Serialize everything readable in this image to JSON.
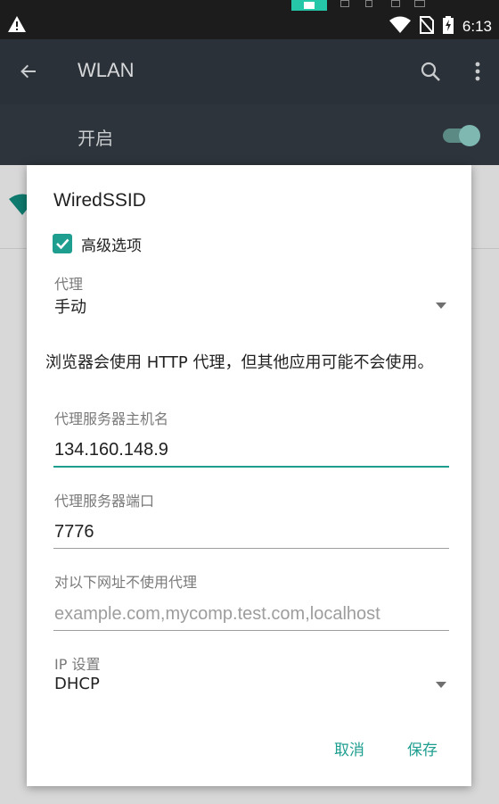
{
  "status_bar": {
    "time": "6:13"
  },
  "app_bar": {
    "title": "WLAN"
  },
  "switch_row": {
    "label": "开启",
    "enabled": true
  },
  "dialog": {
    "title": "WiredSSID",
    "advanced_options": {
      "label": "高级选项",
      "checked": true
    },
    "proxy": {
      "label": "代理",
      "value": "手动"
    },
    "note": "浏览器会使用 HTTP 代理，但其他应用可能不会使用。",
    "proxy_hostname": {
      "label": "代理服务器主机名",
      "value": "134.160.148.9"
    },
    "proxy_port": {
      "label": "代理服务器端口",
      "value": "7776"
    },
    "bypass": {
      "label": "对以下网址不使用代理",
      "placeholder": "example.com,mycomp.test.com,localhost"
    },
    "ip_settings": {
      "label": "IP 设置",
      "value": "DHCP"
    },
    "cancel_label": "取消",
    "save_label": "保存"
  },
  "colors": {
    "accent": "#1d9e8f",
    "appbar": "#2b3138",
    "statusbar": "#1c1c1c"
  },
  "icons": [
    "warning-icon",
    "wifi-status-icon",
    "no-sim-icon",
    "battery-charging-icon",
    "back-arrow-icon",
    "search-icon",
    "more-vert-icon",
    "wifi-icon",
    "checkbox-checked-icon",
    "dropdown-arrow-icon"
  ]
}
